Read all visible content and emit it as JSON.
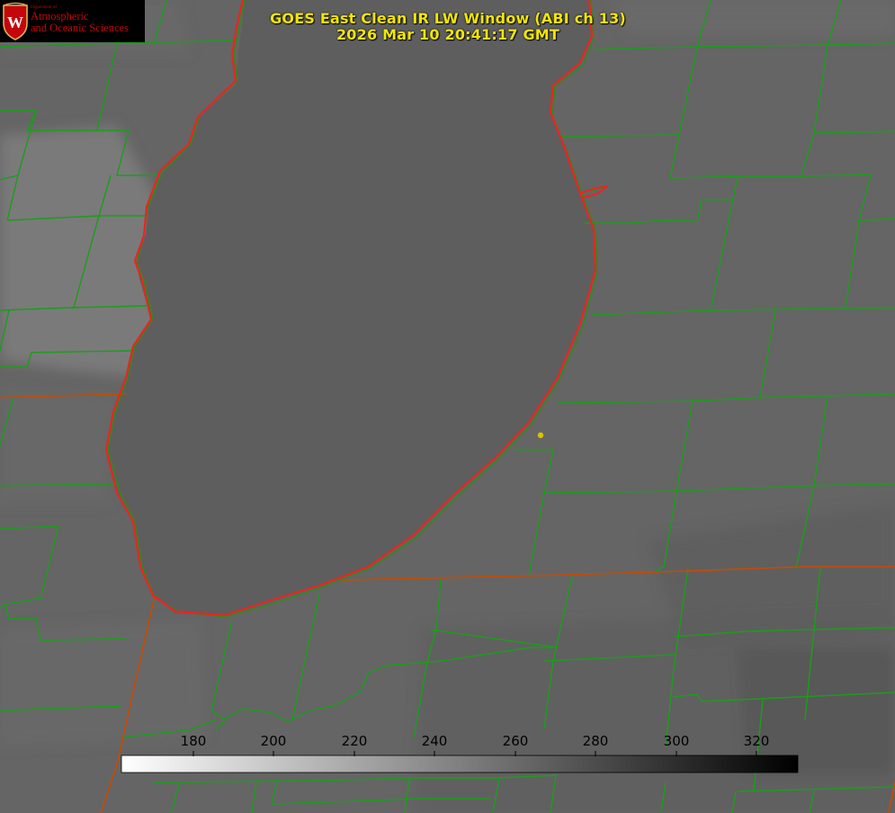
{
  "title": {
    "line1": "GOES East Clean IR LW Window (ABI ch 13)",
    "line2": "2026 Mar 10 20:41:17 GMT"
  },
  "logo": {
    "department": "Department of",
    "line1": "Atmospheric",
    "line2": "and Oceanic Sciences",
    "icon": "uw-crest-icon"
  },
  "colorbar": {
    "ticks": [
      "180",
      "200",
      "220",
      "240",
      "260",
      "280",
      "300",
      "320"
    ],
    "gradient": [
      "#ffffff",
      "#000000"
    ]
  },
  "colors": {
    "title": "#f2e600",
    "county_borders": "#1a9e1a",
    "state_borders": "#c84a00",
    "lake_outline": "#ee2222",
    "marker": "#d7c400",
    "background": "#666666"
  }
}
